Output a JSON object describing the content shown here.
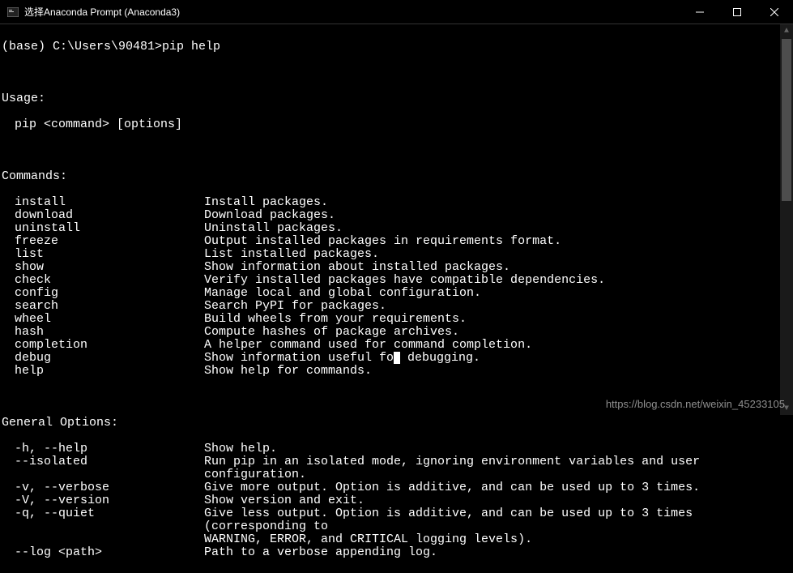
{
  "window": {
    "title": "选择Anaconda Prompt (Anaconda3)"
  },
  "prompt": {
    "prefix": "(base) C:\\Users\\90481>",
    "command": "pip help"
  },
  "usage": {
    "header": "Usage:",
    "line": "pip <command> [options]"
  },
  "commands_header": "Commands:",
  "commands": [
    {
      "name": "install",
      "desc": "Install packages."
    },
    {
      "name": "download",
      "desc": "Download packages."
    },
    {
      "name": "uninstall",
      "desc": "Uninstall packages."
    },
    {
      "name": "freeze",
      "desc": "Output installed packages in requirements format."
    },
    {
      "name": "list",
      "desc": "List installed packages."
    },
    {
      "name": "show",
      "desc": "Show information about installed packages."
    },
    {
      "name": "check",
      "desc": "Verify installed packages have compatible dependencies."
    },
    {
      "name": "config",
      "desc": "Manage local and global configuration."
    },
    {
      "name": "search",
      "desc": "Search PyPI for packages."
    },
    {
      "name": "wheel",
      "desc": "Build wheels from your requirements."
    },
    {
      "name": "hash",
      "desc": "Compute hashes of package archives."
    },
    {
      "name": "completion",
      "desc": "A helper command used for command completion."
    },
    {
      "name": "debug",
      "desc_pre": "Show information useful fo",
      "desc_post": " debugging.",
      "cursor": true
    },
    {
      "name": "help",
      "desc": "Show help for commands."
    }
  ],
  "options_header": "General Options:",
  "options": [
    {
      "name": "-h, --help",
      "desc": "Show help."
    },
    {
      "name": "--isolated",
      "desc": "Run pip in an isolated mode, ignoring environment variables and user configuration."
    },
    {
      "name": "-v, --verbose",
      "desc": "Give more output. Option is additive, and can be used up to 3 times."
    },
    {
      "name": "-V, --version",
      "desc": "Show version and exit."
    },
    {
      "name": "-q, --quiet",
      "desc": "Give less output. Option is additive, and can be used up to 3 times (corresponding to",
      "cont": "WARNING, ERROR, and CRITICAL logging levels)."
    },
    {
      "name": "--log <path>",
      "desc": "Path to a verbose appending log."
    }
  ],
  "watermark": "https://blog.csdn.net/weixin_45233105"
}
